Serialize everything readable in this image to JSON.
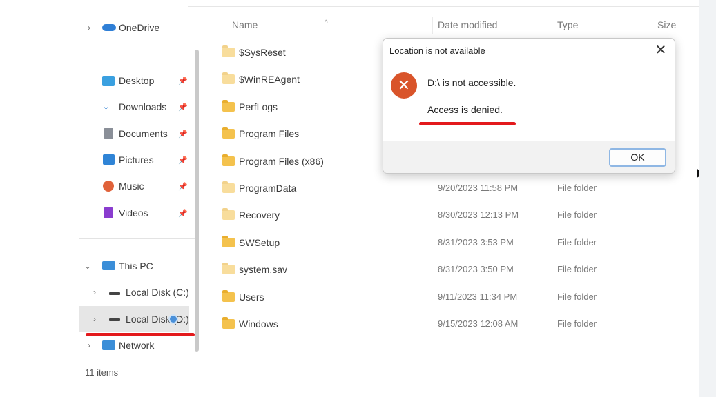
{
  "sidebar": {
    "onedrive": "OneDrive",
    "quick_access": [
      {
        "label": "Desktop",
        "icon": "desktop-icon",
        "color": "#3aa0e0"
      },
      {
        "label": "Downloads",
        "icon": "download-icon",
        "color": "#2d7fd3"
      },
      {
        "label": "Documents",
        "icon": "document-icon",
        "color": "#8a8f98"
      },
      {
        "label": "Pictures",
        "icon": "pictures-icon",
        "color": "#2f84d6"
      },
      {
        "label": "Music",
        "icon": "music-icon",
        "color": "#e0623a"
      },
      {
        "label": "Videos",
        "icon": "videos-icon",
        "color": "#8a3ccf"
      }
    ],
    "this_pc": "This PC",
    "local_c": "Local Disk (C:)",
    "local_d": "Local Disk (D:)",
    "network": "Network"
  },
  "status": {
    "items_count": "11 items"
  },
  "columns": {
    "name": "Name",
    "date_modified": "Date modified",
    "type": "Type",
    "size": "Size"
  },
  "files": [
    {
      "name": "$SysReset",
      "date": "",
      "type": "",
      "faded": true
    },
    {
      "name": "$WinREAgent",
      "date": "",
      "type": "",
      "faded": true
    },
    {
      "name": "PerfLogs",
      "date": "",
      "type": ""
    },
    {
      "name": "Program Files",
      "date": "",
      "type": ""
    },
    {
      "name": "Program Files (x86)",
      "date": "",
      "type": ""
    },
    {
      "name": "ProgramData",
      "date": "9/20/2023 11:58 PM",
      "type": "File folder",
      "faded": true
    },
    {
      "name": "Recovery",
      "date": "8/30/2023 12:13 PM",
      "type": "File folder",
      "faded": true
    },
    {
      "name": "SWSetup",
      "date": "8/31/2023 3:53 PM",
      "type": "File folder"
    },
    {
      "name": "system.sav",
      "date": "8/31/2023 3:50 PM",
      "type": "File folder",
      "faded": true
    },
    {
      "name": "Users",
      "date": "9/11/2023 11:34 PM",
      "type": "File folder"
    },
    {
      "name": "Windows",
      "date": "9/15/2023 12:08 AM",
      "type": "File folder"
    }
  ],
  "dialog": {
    "title": "Location is not available",
    "message": "D:\\ is not accessible.",
    "detail": "Access is denied.",
    "ok_label": "OK",
    "close_glyph": "✕",
    "error_glyph": "✕"
  },
  "colors": {
    "highlight_red": "#e3191c",
    "error_orange": "#d9542a",
    "folder_yellow": "#f4c24d"
  }
}
